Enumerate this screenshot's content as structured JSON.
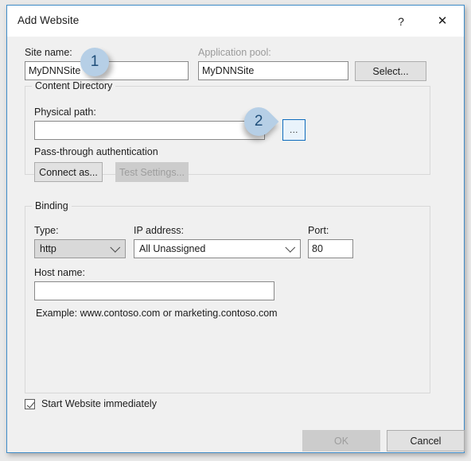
{
  "window": {
    "title": "Add Website",
    "help_icon": "?",
    "close_icon": "✕"
  },
  "site": {
    "name_label": "Site name:",
    "name_value": "MyDNNSite",
    "app_pool_label": "Application pool:",
    "app_pool_value": "MyDNNSite",
    "select_button": "Select..."
  },
  "content_directory": {
    "group_title": "Content Directory",
    "physical_path_label": "Physical path:",
    "physical_path_value": "",
    "browse_button": "...",
    "pass_through_text": "Pass-through authentication",
    "connect_as_button": "Connect as...",
    "test_settings_button": "Test Settings..."
  },
  "binding": {
    "group_title": "Binding",
    "type_label": "Type:",
    "type_value": "http",
    "ip_label": "IP address:",
    "ip_value": "All Unassigned",
    "port_label": "Port:",
    "port_value": "80",
    "host_label": "Host name:",
    "host_value": "",
    "host_placeholder": "",
    "example_text": "Example: www.contoso.com or marketing.contoso.com"
  },
  "footer": {
    "start_checkbox_label": "Start Website immediately",
    "ok_button": "OK",
    "cancel_button": "Cancel"
  },
  "annotations": {
    "badge_one": "1",
    "badge_two": "2"
  },
  "colors": {
    "window_border": "#3f8cc9",
    "badge_fill": "#b6cfe6",
    "badge_text": "#1f4e79",
    "focus_blue": "#0f6cbd",
    "dialog_bg": "#f0f0f0"
  }
}
